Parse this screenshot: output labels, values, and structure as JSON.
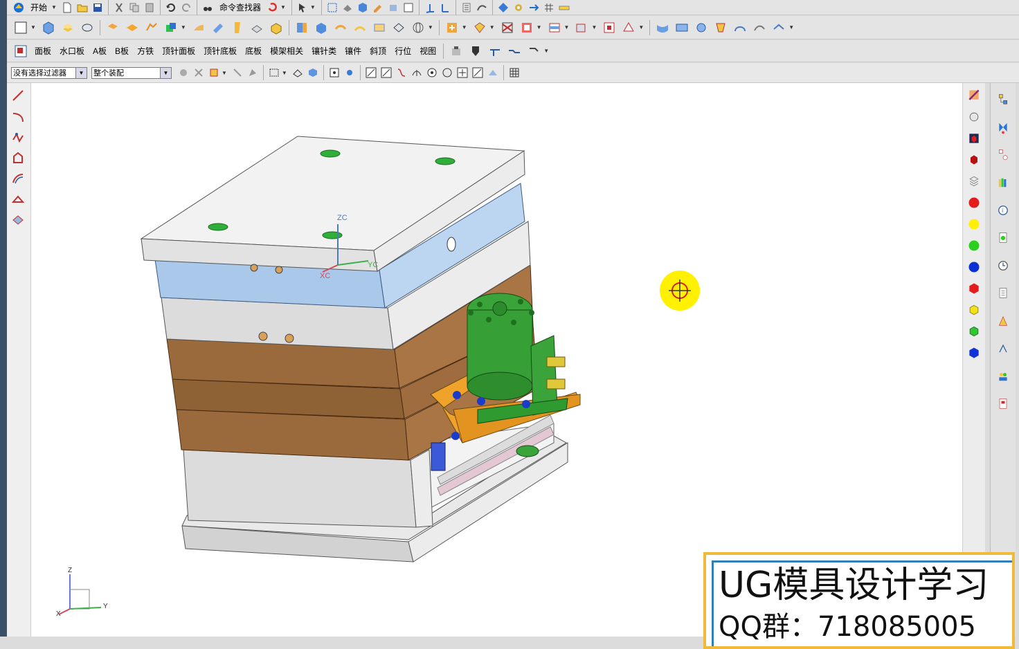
{
  "toolbar_row1": {
    "start_label": "开始",
    "command_finder_label": "命令查找器"
  },
  "toolbar_row3": {
    "items": [
      "面板",
      "水口板",
      "A板",
      "B板",
      "方铁",
      "顶针面板",
      "顶针底板",
      "底板",
      "模架相关",
      "镶针类",
      "镶件",
      "斜顶",
      "行位",
      "视图"
    ]
  },
  "selection_bar": {
    "filter_value": "没有选择过滤器",
    "scope_value": "整个装配"
  },
  "viewport": {
    "wcs_labels": {
      "zc": "ZC",
      "yc": "YC",
      "xc": "XC"
    },
    "triad_labels": {
      "z": "Z",
      "y": "Y",
      "x": "X"
    }
  },
  "palette_colors": [
    "#e41b1b",
    "#ffef00",
    "#2bd01c",
    "#0a2fd6",
    "#e41b1b",
    "#f3e11a",
    "#32c633",
    "#1032d8"
  ],
  "watermark": {
    "title": "UG模具设计学习",
    "subtitle": "QQ群：718085005"
  },
  "colors": {
    "accent_yellow": "#f1b93a",
    "accent_blue": "#2f7fb8",
    "plate_blue": "#a9c8ea",
    "plate_grey": "#dcdcdc",
    "plate_brown": "#9b6a3c",
    "cylinder_green": "#3aa43a",
    "bracket_orange": "#f0a32a"
  }
}
